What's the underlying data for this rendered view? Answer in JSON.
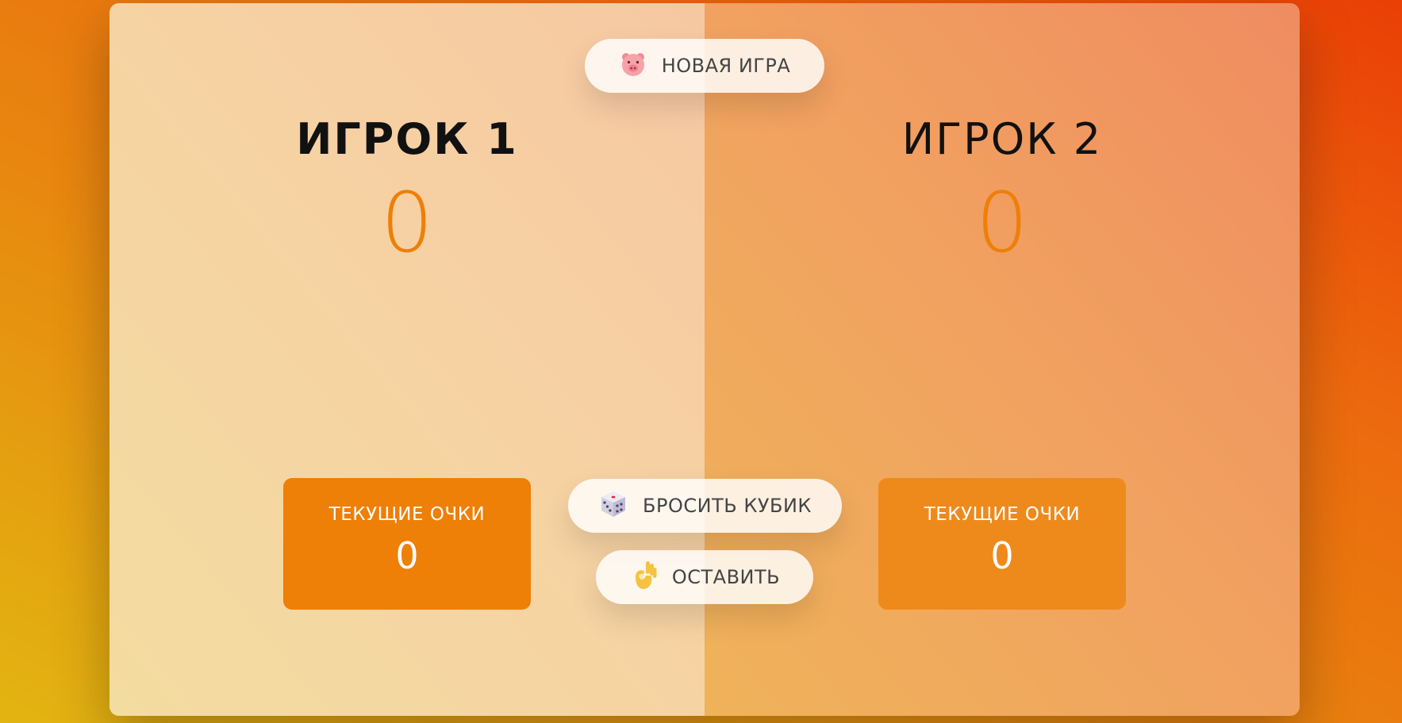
{
  "players": [
    {
      "name": "ИГРОК 1",
      "total_score": "0",
      "current_label": "ТЕКУЩИЕ ОЧКИ",
      "current_score": "0",
      "active": true
    },
    {
      "name": "ИГРОК 2",
      "total_score": "0",
      "current_label": "ТЕКУЩИЕ ОЧКИ",
      "current_score": "0",
      "active": false
    }
  ],
  "buttons": {
    "new_game": {
      "label": "НОВАЯ ИГРА",
      "icon": "pig-icon"
    },
    "roll_dice": {
      "label": "БРОСИТЬ КУБИК",
      "icon": "dice-icon"
    },
    "hold": {
      "label": "ОСТАВИТЬ",
      "icon": "ok-hand-icon"
    }
  },
  "colors": {
    "accent": "#ee7f07",
    "active_panel": "#f6d3a3",
    "inactive_panel": "#f1a060"
  }
}
